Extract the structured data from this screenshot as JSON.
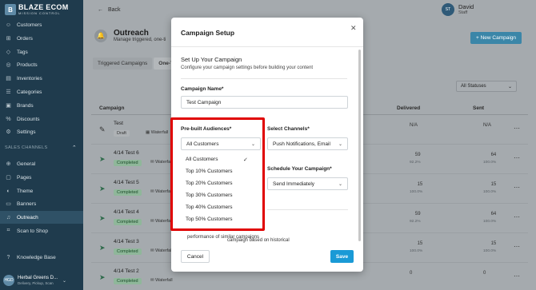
{
  "sidebar": {
    "logo_main": "BLAZE ECOM",
    "logo_sub": "MISSION CONTROL",
    "items": [
      {
        "label": "Customers",
        "icon": "users-icon"
      },
      {
        "label": "Orders",
        "icon": "cart-icon"
      },
      {
        "label": "Tags",
        "icon": "tag-icon"
      },
      {
        "label": "Products",
        "icon": "box-icon"
      },
      {
        "label": "Inventories",
        "icon": "inventory-icon"
      },
      {
        "label": "Categories",
        "icon": "category-icon"
      },
      {
        "label": "Brands",
        "icon": "brand-icon"
      },
      {
        "label": "Discounts",
        "icon": "discount-icon"
      },
      {
        "label": "Settings",
        "icon": "gear-icon"
      }
    ],
    "section_label": "SALES CHANNELS",
    "channel_items": [
      {
        "label": "General",
        "icon": "globe-icon"
      },
      {
        "label": "Pages",
        "icon": "page-icon"
      },
      {
        "label": "Theme",
        "icon": "theme-icon"
      },
      {
        "label": "Banners",
        "icon": "banner-icon"
      },
      {
        "label": "Outreach",
        "icon": "bell-icon"
      },
      {
        "label": "Scan to Shop",
        "icon": "scan-icon"
      }
    ],
    "knowledge_base": "Knowledge Base",
    "store": {
      "avatar": "HGD",
      "name": "Herbal Greens D...",
      "sub": "Delivery, Pickup, Scan"
    }
  },
  "header": {
    "back": "Back",
    "user_initials": "ST",
    "user_name": "David",
    "user_role": "Staff"
  },
  "page": {
    "title": "Outreach",
    "subtitle": "Manage triggered, one-ti",
    "new_button": "+ New Campaign",
    "tabs": [
      "Triggered Campaigns",
      "One-Ti"
    ],
    "status_select": "All Statuses"
  },
  "table": {
    "headers": {
      "campaign": "Campaign",
      "delivered": "Delivered",
      "sent": "Sent"
    },
    "rows": [
      {
        "name": "Test",
        "status": "Draft",
        "type": "Waterfall",
        "delivered": "N/A",
        "delivered_pct": "",
        "sent": "N/A",
        "sent_pct": ""
      },
      {
        "name": "4/14 Test 6",
        "status": "Completed",
        "type": "Waterfall",
        "delivered": "59",
        "delivered_pct": "92.2%",
        "sent": "64",
        "sent_pct": "100.0%"
      },
      {
        "name": "4/14 Test 5",
        "status": "Completed",
        "type": "Waterfall",
        "delivered": "15",
        "delivered_pct": "100.0%",
        "sent": "15",
        "sent_pct": "100.0%"
      },
      {
        "name": "4/14 Test 4",
        "status": "Completed",
        "type": "Waterfall",
        "delivered": "59",
        "delivered_pct": "92.2%",
        "sent": "64",
        "sent_pct": "100.0%"
      },
      {
        "name": "4/14 Test 3",
        "status": "Completed",
        "type": "Waterfall",
        "delivered": "15",
        "delivered_pct": "100.0%",
        "sent": "15",
        "sent_pct": "100.0%"
      },
      {
        "name": "4/14 Test 2",
        "status": "Completed",
        "type": "Waterfall",
        "delivered": "0",
        "delivered_pct": "",
        "sent": "0",
        "sent_pct": ""
      }
    ]
  },
  "modal": {
    "title": "Campaign Setup",
    "setup_title": "Set Up Your Campaign",
    "setup_sub": "Configure your campaign settings before building your content",
    "name_label": "Campaign Name*",
    "name_value": "Test Campaign",
    "audience_label": "Pre-built Audiences*",
    "audience_value": "All Customers",
    "audience_options": [
      "All Customers",
      "Top 10% Customers",
      "Top 20% Customers",
      "Top 30% Customers",
      "Top 40% Customers",
      "Top 50% Customers"
    ],
    "channels_label": "Select Channels*",
    "channels_value": "Push Notifications, Email",
    "schedule_label": "Schedule Your Campaign*",
    "schedule_value": "Send Immediately",
    "note_line1": "campaign based on historical",
    "note_line2": "performance of similar campaigns",
    "cancel": "Cancel",
    "save": "Save"
  },
  "colors": {
    "accent": "#1a9ad6",
    "highlight": "#e00000",
    "sidebar": "#1f3b4d"
  }
}
